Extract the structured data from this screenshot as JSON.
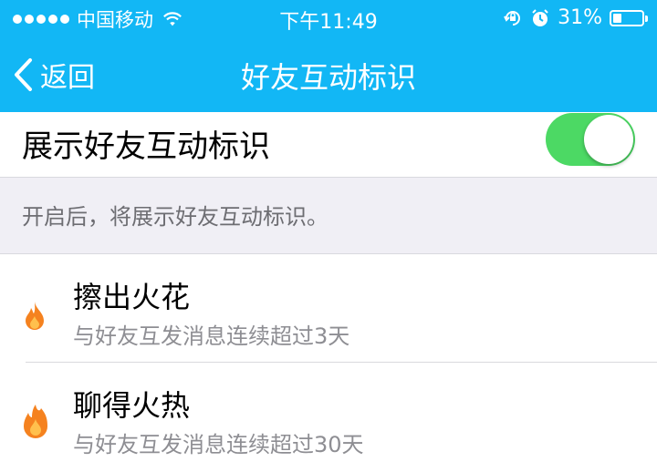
{
  "status_bar": {
    "carrier": "中国移动",
    "time": "下午11:49",
    "battery_percent": "31%",
    "battery_level": 0.31
  },
  "nav": {
    "back_label": "返回",
    "title": "好友互动标识"
  },
  "setting": {
    "label": "展示好友互动标识",
    "enabled": true,
    "hint": "开启后，将展示好友互动标识。"
  },
  "items": [
    {
      "title": "擦出火花",
      "subtitle": "与好友互发消息连续超过3天",
      "icon": "small-flame-icon"
    },
    {
      "title": "聊得火热",
      "subtitle": "与好友互发消息连续超过30天",
      "icon": "big-flame-icon"
    }
  ],
  "colors": {
    "accent": "#12b7f5",
    "switch_on": "#4cd964",
    "flame": "#f5821f"
  }
}
